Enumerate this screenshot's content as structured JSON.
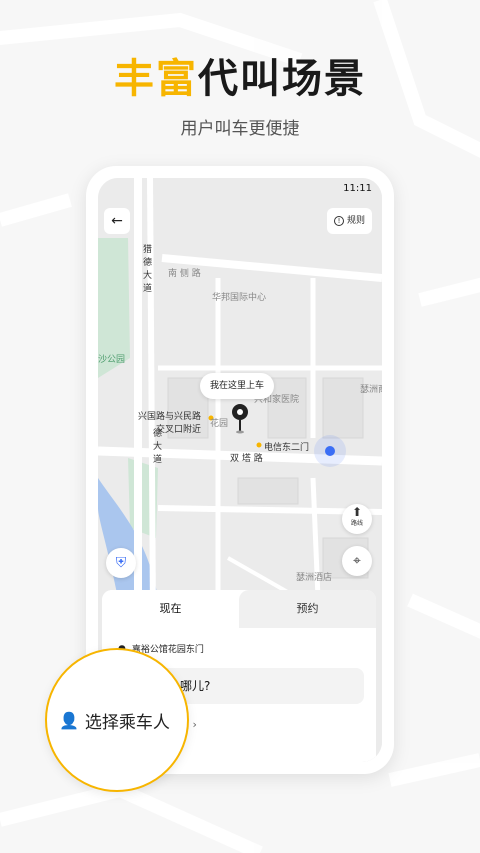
{
  "header": {
    "title_accent": "丰富",
    "title_rest": "代叫场景",
    "subtitle": "用户叫车更便捷"
  },
  "status_bar": {
    "time": "11:11"
  },
  "top_bar": {
    "back_icon": "arrow-left-icon",
    "rules_label": "规则"
  },
  "map": {
    "labels": {
      "south_road": "南 侧 路",
      "huabang": "华邦国际中心",
      "jinde_avenue_top": "猎德大道",
      "jinde_avenue_bottom": "德大道",
      "park": "沙公园",
      "hospital": "兴和家医院",
      "xingguo_1": "兴国路与兴民路",
      "xingguo_2": "交叉口附近",
      "telecom": "电信东二门",
      "shuangta": "双 塔 路",
      "hotel": "瑟洲酒店",
      "commerce": "瑟洲商务",
      "park_label": "花园"
    },
    "pickup_bubble": "我在这里上车",
    "route_label": "路线"
  },
  "sheet": {
    "tabs": [
      "现在",
      "预约"
    ],
    "origin": "嘉裕公馆花园东门",
    "destination_visible": "哪儿?",
    "passenger_partial": "人 ›"
  },
  "magnifier": {
    "label": "选择乘车人"
  },
  "colors": {
    "accent": "#f7b500",
    "location_blue": "#3b6ef5"
  }
}
